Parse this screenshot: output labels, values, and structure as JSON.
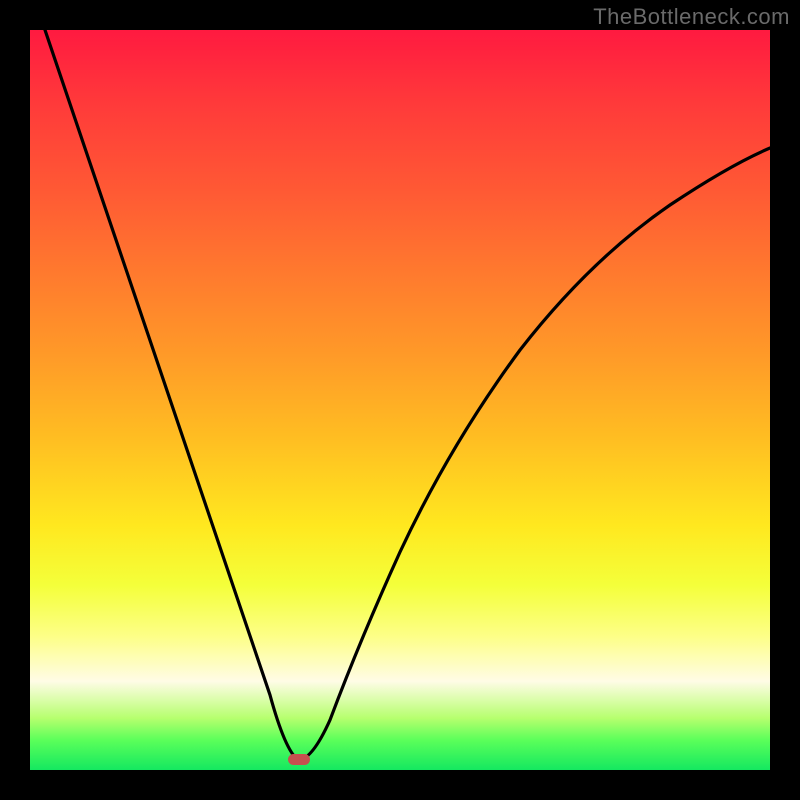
{
  "watermark": "TheBottleneck.com",
  "chart_data": {
    "type": "line",
    "title": "",
    "xlabel": "",
    "ylabel": "",
    "x": [
      0,
      5,
      10,
      15,
      20,
      25,
      30,
      33,
      35,
      37,
      40,
      45,
      50,
      55,
      60,
      65,
      70,
      75,
      80,
      85,
      90,
      95,
      100
    ],
    "values": [
      100,
      84,
      69,
      53,
      38,
      22,
      7,
      0,
      5,
      12,
      22,
      36,
      46,
      54,
      60,
      65,
      69,
      72,
      75,
      77,
      79,
      80,
      81
    ],
    "xlim": [
      0,
      100
    ],
    "ylim": [
      0,
      100
    ],
    "marker": {
      "x": 33,
      "y": 0
    },
    "gradient_stops": [
      {
        "pos": 0,
        "color": "#ff1a40"
      },
      {
        "pos": 33,
        "color": "#ff7a2e"
      },
      {
        "pos": 67,
        "color": "#ffe81f"
      },
      {
        "pos": 88,
        "color": "#fffce6"
      },
      {
        "pos": 100,
        "color": "#14e860"
      }
    ]
  }
}
